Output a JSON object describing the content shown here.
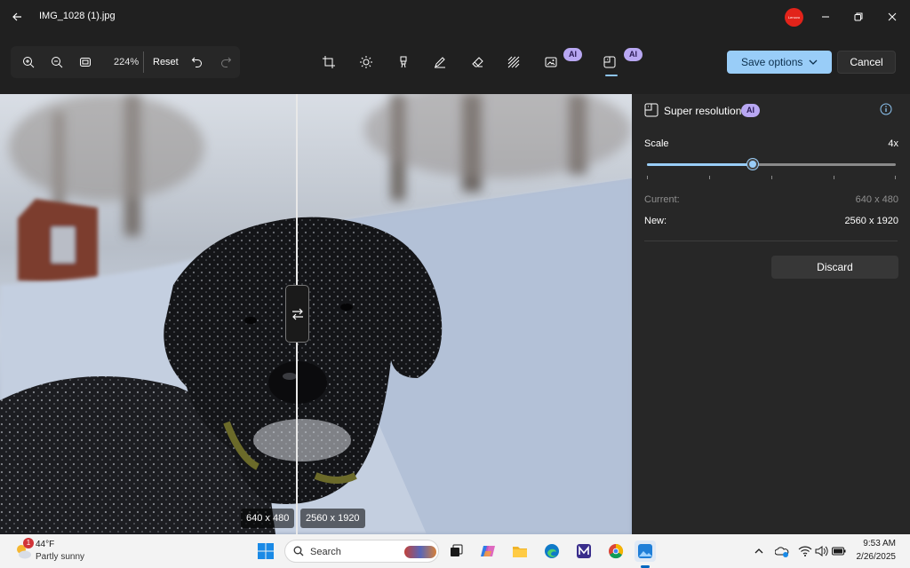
{
  "window": {
    "file_title": "IMG_1028 (1).jpg",
    "lenovo_badge": "Lenovo"
  },
  "toolbar": {
    "zoom_level": "224%",
    "reset_label": "Reset",
    "ai_label": "AI",
    "save_options_label": "Save options",
    "cancel_label": "Cancel",
    "accent_color": "#99cdf8"
  },
  "canvas": {
    "left_size": "640 x 480",
    "right_size": "2560 x 1920"
  },
  "panel": {
    "title": "Super resolution",
    "ai_label": "AI",
    "scale_label": "Scale",
    "scale_value": "4x",
    "slider_fraction": 0.43,
    "current_label": "Current:",
    "current_value": "640 x 480",
    "new_label": "New:",
    "new_value": "2560 x 1920",
    "discard_label": "Discard"
  },
  "taskbar": {
    "weather_badge": "1",
    "weather_temp": "44°F",
    "weather_desc": "Partly sunny",
    "search_placeholder": "Search",
    "time": "9:53 AM",
    "date": "2/26/2025"
  }
}
